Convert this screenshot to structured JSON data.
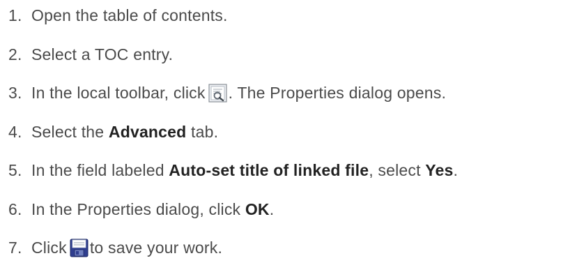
{
  "steps": [
    {
      "number": "1.",
      "text": "Open the table of contents."
    },
    {
      "number": "2.",
      "text": "Select a TOC entry."
    },
    {
      "number": "3.",
      "before": "In the local toolbar, click",
      "icon": "properties-icon",
      "after": ". The Properties dialog opens."
    },
    {
      "number": "4.",
      "before": "Select the ",
      "bold": "Advanced",
      "after": " tab."
    },
    {
      "number": "5.",
      "before": "In the field labeled ",
      "bold": "Auto-set title of linked file",
      "middle": ", select ",
      "bold2": "Yes",
      "after": "."
    },
    {
      "number": "6.",
      "before": "In the Properties dialog, click ",
      "bold": "OK",
      "after": "."
    },
    {
      "number": "7.",
      "before": "Click",
      "icon": "save-icon",
      "after": "to save your work."
    }
  ]
}
